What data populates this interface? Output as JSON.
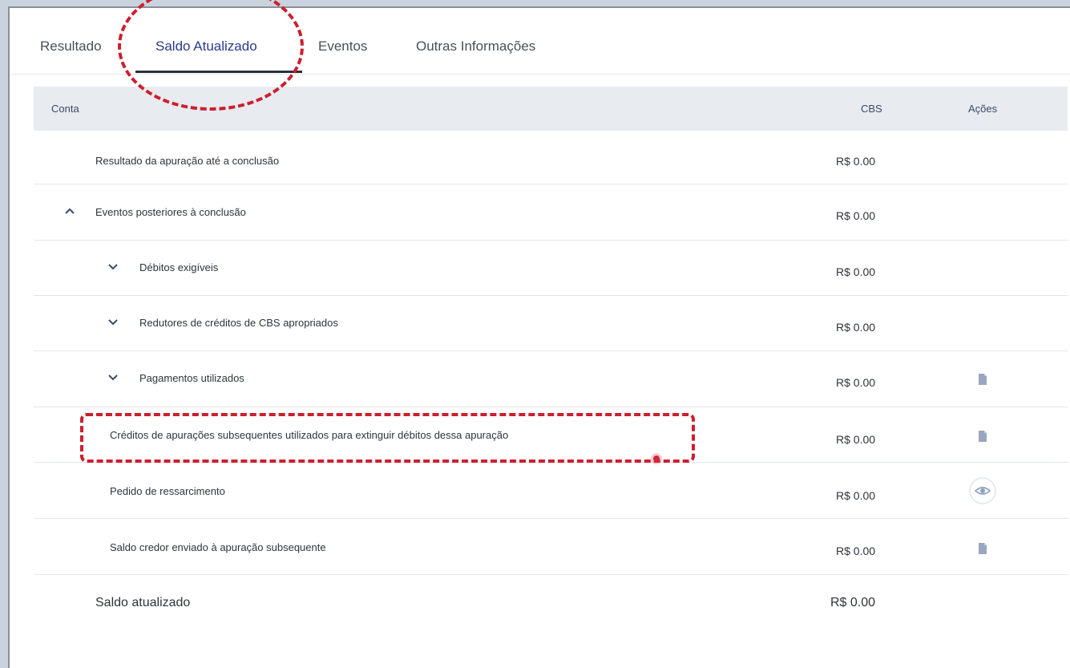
{
  "tabs": [
    {
      "label": "Resultado"
    },
    {
      "label": "Saldo Atualizado"
    },
    {
      "label": "Eventos"
    },
    {
      "label": "Outras Informações"
    }
  ],
  "active_tab": "Saldo Atualizado",
  "table": {
    "headers": {
      "conta": "Conta",
      "cbs": "CBS",
      "acoes": "Ações"
    },
    "rows": [
      {
        "label": "Resultado da apuração até a conclusão",
        "value": "R$ 0.00"
      },
      {
        "label": "Eventos posteriores à conclusão",
        "value": "R$ 0.00",
        "toggle": "^"
      },
      {
        "label": "Débitos exigíveis",
        "value": "R$ 0.00",
        "toggle": "v"
      },
      {
        "label": "Redutores de créditos de CBS apropriados",
        "value": "R$ 0.00",
        "toggle": "v"
      },
      {
        "label": "Pagamentos utilizados",
        "value": "R$ 0.00",
        "toggle": "v",
        "action": "document-icon"
      },
      {
        "label": "Créditos de apurações subsequentes utilizados para extinguir débitos dessa apuração",
        "value": "R$ 0.00",
        "action": "document-icon"
      },
      {
        "label": "Pedido de ressarcimento",
        "value": "R$ 0.00",
        "action": "eye-icon"
      },
      {
        "label": "Saldo credor enviado à apuração subsequente",
        "value": "R$ 0.00",
        "action": "document-icon"
      }
    ],
    "total": {
      "label": "Saldo atualizado",
      "value": "R$ 0.00"
    }
  },
  "colors": {
    "accent": "#2a3a8c",
    "annotation": "#cc1f2e",
    "header_bg": "#e8ebef"
  }
}
